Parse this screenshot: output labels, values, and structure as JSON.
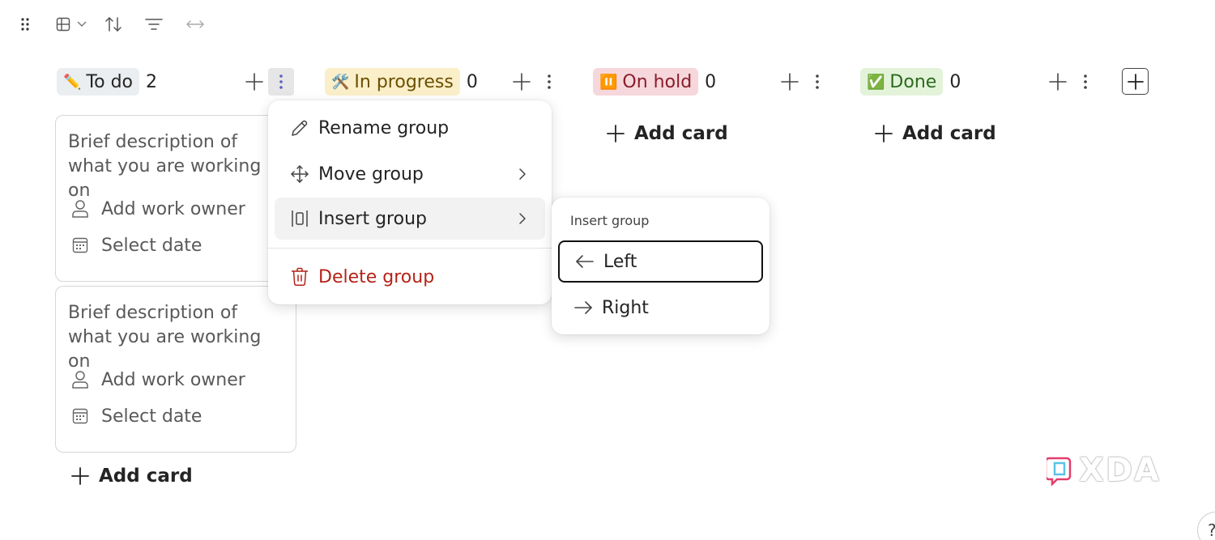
{
  "toolbar": {
    "icons": [
      "drag-handle-icon",
      "layout-icon",
      "chevron-down-icon",
      "sort-icon",
      "filter-icon",
      "expand-width-icon"
    ]
  },
  "columns": [
    {
      "emoji": "✏️",
      "title": "To do",
      "count": "2",
      "color": "#ebeef0"
    },
    {
      "emoji": "🛠️",
      "title": "In progress",
      "count": "0",
      "color": "#fbefc9"
    },
    {
      "emoji": "⏸️",
      "title": "On hold",
      "count": "0",
      "color": "#f6d7db"
    },
    {
      "emoji": "✅",
      "title": "Done",
      "count": "0",
      "color": "#e3f3da"
    }
  ],
  "cards": [
    {
      "description": "Brief description of what you are working on",
      "owner": "Add work owner",
      "date": "Select date"
    },
    {
      "description": "Brief description of what you are working on",
      "owner": "Add work owner",
      "date": "Select date"
    }
  ],
  "add_card_label": "Add card",
  "group_menu": {
    "items": [
      {
        "label": "Rename group",
        "icon": "pencil-icon"
      },
      {
        "label": "Move group",
        "icon": "move-arrows-icon"
      },
      {
        "label": "Insert group",
        "icon": "insert-column-icon"
      },
      {
        "label": "Delete group",
        "icon": "trash-icon"
      }
    ]
  },
  "insert_submenu": {
    "title": "Insert group",
    "items": [
      {
        "label": "Left",
        "icon": "arrow-left-icon"
      },
      {
        "label": "Right",
        "icon": "arrow-right-icon"
      }
    ]
  },
  "watermark": "XDA",
  "help_label": "?",
  "colors": {
    "danger": "#b42318",
    "menu_hover": "#f2f2f2"
  }
}
